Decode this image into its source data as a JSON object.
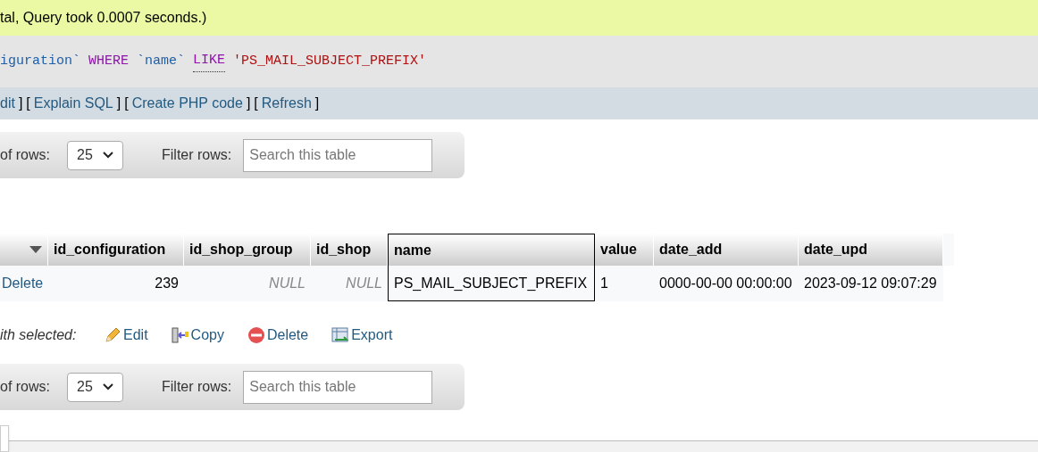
{
  "status_message": "tal, Query took 0.0007 seconds.)",
  "sql_tokens": [
    {
      "text": "iguration`",
      "kind": "identifier"
    },
    {
      "text": "WHERE",
      "kind": "keyword"
    },
    {
      "text": "`name`",
      "kind": "identifier"
    },
    {
      "text": "LIKE",
      "kind": "function"
    },
    {
      "text": "'PS_MAIL_SUBJECT_PREFIX'",
      "kind": "string"
    }
  ],
  "query_links": [
    {
      "text": "dit",
      "close": "]"
    },
    {
      "open": "[",
      "text": "Explain SQL",
      "close": "]"
    },
    {
      "open": "[",
      "text": "Create PHP code",
      "close": "]"
    },
    {
      "open": "[",
      "text": "Refresh",
      "close": "]"
    }
  ],
  "top_navigation": {
    "rows_label": "of rows:",
    "rows_value": "25",
    "filter_label": "Filter rows:",
    "search_placeholder": "Search this table"
  },
  "table": {
    "columns": [
      {
        "kind": "sort",
        "highlighted": false
      },
      {
        "label": "id_configuration",
        "kind": "column",
        "highlighted": false
      },
      {
        "label": "id_shop_group",
        "kind": "column",
        "highlighted": false
      },
      {
        "label": "id_shop",
        "kind": "column",
        "highlighted": false
      },
      {
        "label": "name",
        "kind": "column",
        "highlighted": true
      },
      {
        "label": "value",
        "kind": "column",
        "highlighted": false
      },
      {
        "label": "date_add",
        "kind": "column",
        "highlighted": false
      },
      {
        "label": "date_upd",
        "kind": "column",
        "highlighted": false
      }
    ],
    "rows": [
      [
        {
          "text": "Delete",
          "kind": "link"
        },
        {
          "text": "239",
          "kind": "number"
        },
        {
          "text": "NULL",
          "kind": "null"
        },
        {
          "text": "NULL",
          "kind": "null"
        },
        {
          "text": "PS_MAIL_SUBJECT_PREFIX",
          "kind": "text"
        },
        {
          "text": "1",
          "kind": "text"
        },
        {
          "text": "0000-00-00 00:00:00",
          "kind": "text"
        },
        {
          "text": "2023-09-12 09:07:29",
          "kind": "text"
        }
      ]
    ]
  },
  "with_selected": {
    "label": "ith selected:",
    "actions": [
      {
        "label": "Edit",
        "kind": "edit"
      },
      {
        "label": "Copy",
        "kind": "copy"
      },
      {
        "label": "Delete",
        "kind": "delete"
      },
      {
        "label": "Export",
        "kind": "export"
      }
    ]
  },
  "bottom_navigation": {
    "rows_label": "of rows:",
    "rows_value": "25",
    "filter_label": "Filter rows:",
    "search_placeholder": "Search this table"
  }
}
